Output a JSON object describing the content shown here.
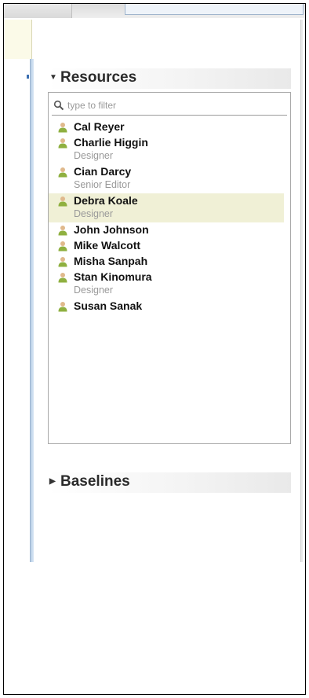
{
  "panel": {
    "resources": {
      "title": "Resources",
      "expanded": true,
      "filter_placeholder": "type to filter",
      "items": [
        {
          "name": "Cal Reyer",
          "role": ""
        },
        {
          "name": "Charlie Higgin",
          "role": "Designer"
        },
        {
          "name": "Cian Darcy",
          "role": "Senior Editor"
        },
        {
          "name": "Debra Koale",
          "role": "Designer",
          "selected": true
        },
        {
          "name": "John Johnson",
          "role": ""
        },
        {
          "name": "Mike Walcott",
          "role": ""
        },
        {
          "name": "Misha Sanpah",
          "role": ""
        },
        {
          "name": "Stan Kinomura",
          "role": "Designer"
        },
        {
          "name": "Susan Sanak",
          "role": ""
        }
      ]
    },
    "baselines": {
      "title": "Baselines",
      "expanded": false
    }
  },
  "icons": {
    "person": "person-icon",
    "search": "search-icon",
    "caret_down": "caret-down-icon",
    "caret_right": "caret-right-icon"
  },
  "colors": {
    "person_icon": "#8fb040",
    "selected_row": "#f0f0d6",
    "role_text": "#999999"
  }
}
